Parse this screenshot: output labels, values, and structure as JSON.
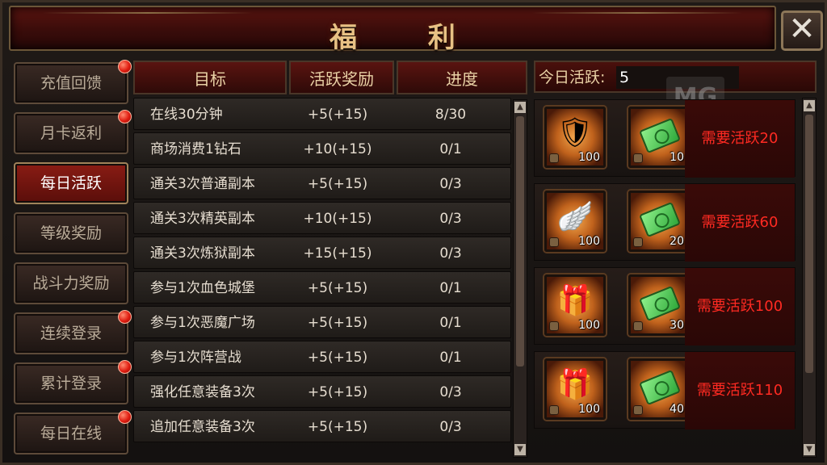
{
  "window": {
    "title": "福 利"
  },
  "sidebar": {
    "items": [
      {
        "label": "充值回馈",
        "badge": true,
        "active": false
      },
      {
        "label": "月卡返利",
        "badge": true,
        "active": false
      },
      {
        "label": "每日活跃",
        "badge": false,
        "active": true
      },
      {
        "label": "等级奖励",
        "badge": false,
        "active": false
      },
      {
        "label": "战斗力奖励",
        "badge": false,
        "active": false
      },
      {
        "label": "连续登录",
        "badge": true,
        "active": false
      },
      {
        "label": "累计登录",
        "badge": true,
        "active": false
      },
      {
        "label": "每日在线",
        "badge": true,
        "active": false
      }
    ]
  },
  "tasks": {
    "headers": {
      "target": "目标",
      "reward": "活跃奖励",
      "progress": "进度"
    },
    "rows": [
      {
        "name": "在线30分钟",
        "reward": "+5(+15)",
        "progress": "8/30"
      },
      {
        "name": "商场消费1钻石",
        "reward": "+10(+15)",
        "progress": "0/1"
      },
      {
        "name": "通关3次普通副本",
        "reward": "+5(+15)",
        "progress": "0/3"
      },
      {
        "name": "通关3次精英副本",
        "reward": "+10(+15)",
        "progress": "0/3"
      },
      {
        "name": "通关3次炼狱副本",
        "reward": "+15(+15)",
        "progress": "0/3"
      },
      {
        "name": "参与1次血色城堡",
        "reward": "+5(+15)",
        "progress": "0/1"
      },
      {
        "name": "参与1次恶魔广场",
        "reward": "+5(+15)",
        "progress": "0/1"
      },
      {
        "name": "参与1次阵营战",
        "reward": "+5(+15)",
        "progress": "0/1"
      },
      {
        "name": "强化任意装备3次",
        "reward": "+5(+15)",
        "progress": "0/3"
      },
      {
        "name": "追加任意装备3次",
        "reward": "+5(+15)",
        "progress": "0/3"
      }
    ]
  },
  "activity": {
    "label": "今日活跃:",
    "value": "5",
    "watermark": "MG"
  },
  "rewards": [
    {
      "item_icon": "armor-icon",
      "item_qty": "100",
      "cash_icon": "cash-icon",
      "cash_qty": "10",
      "requirement": "需要活跃20"
    },
    {
      "item_icon": "wings-icon",
      "item_qty": "100",
      "cash_icon": "cash-icon",
      "cash_qty": "20",
      "requirement": "需要活跃60"
    },
    {
      "item_icon": "chest-icon",
      "item_qty": "100",
      "cash_icon": "cash-icon",
      "cash_qty": "30",
      "requirement": "需要活跃100"
    },
    {
      "item_icon": "chest-icon",
      "item_qty": "100",
      "cash_icon": "cash-icon",
      "cash_qty": "40",
      "requirement": "需要活跃110"
    }
  ],
  "colors": {
    "accent_red": "#ff2a22",
    "gold_text": "#ead2a6",
    "active_tab": "#8a1c14",
    "badge_red": "#e01c10"
  }
}
